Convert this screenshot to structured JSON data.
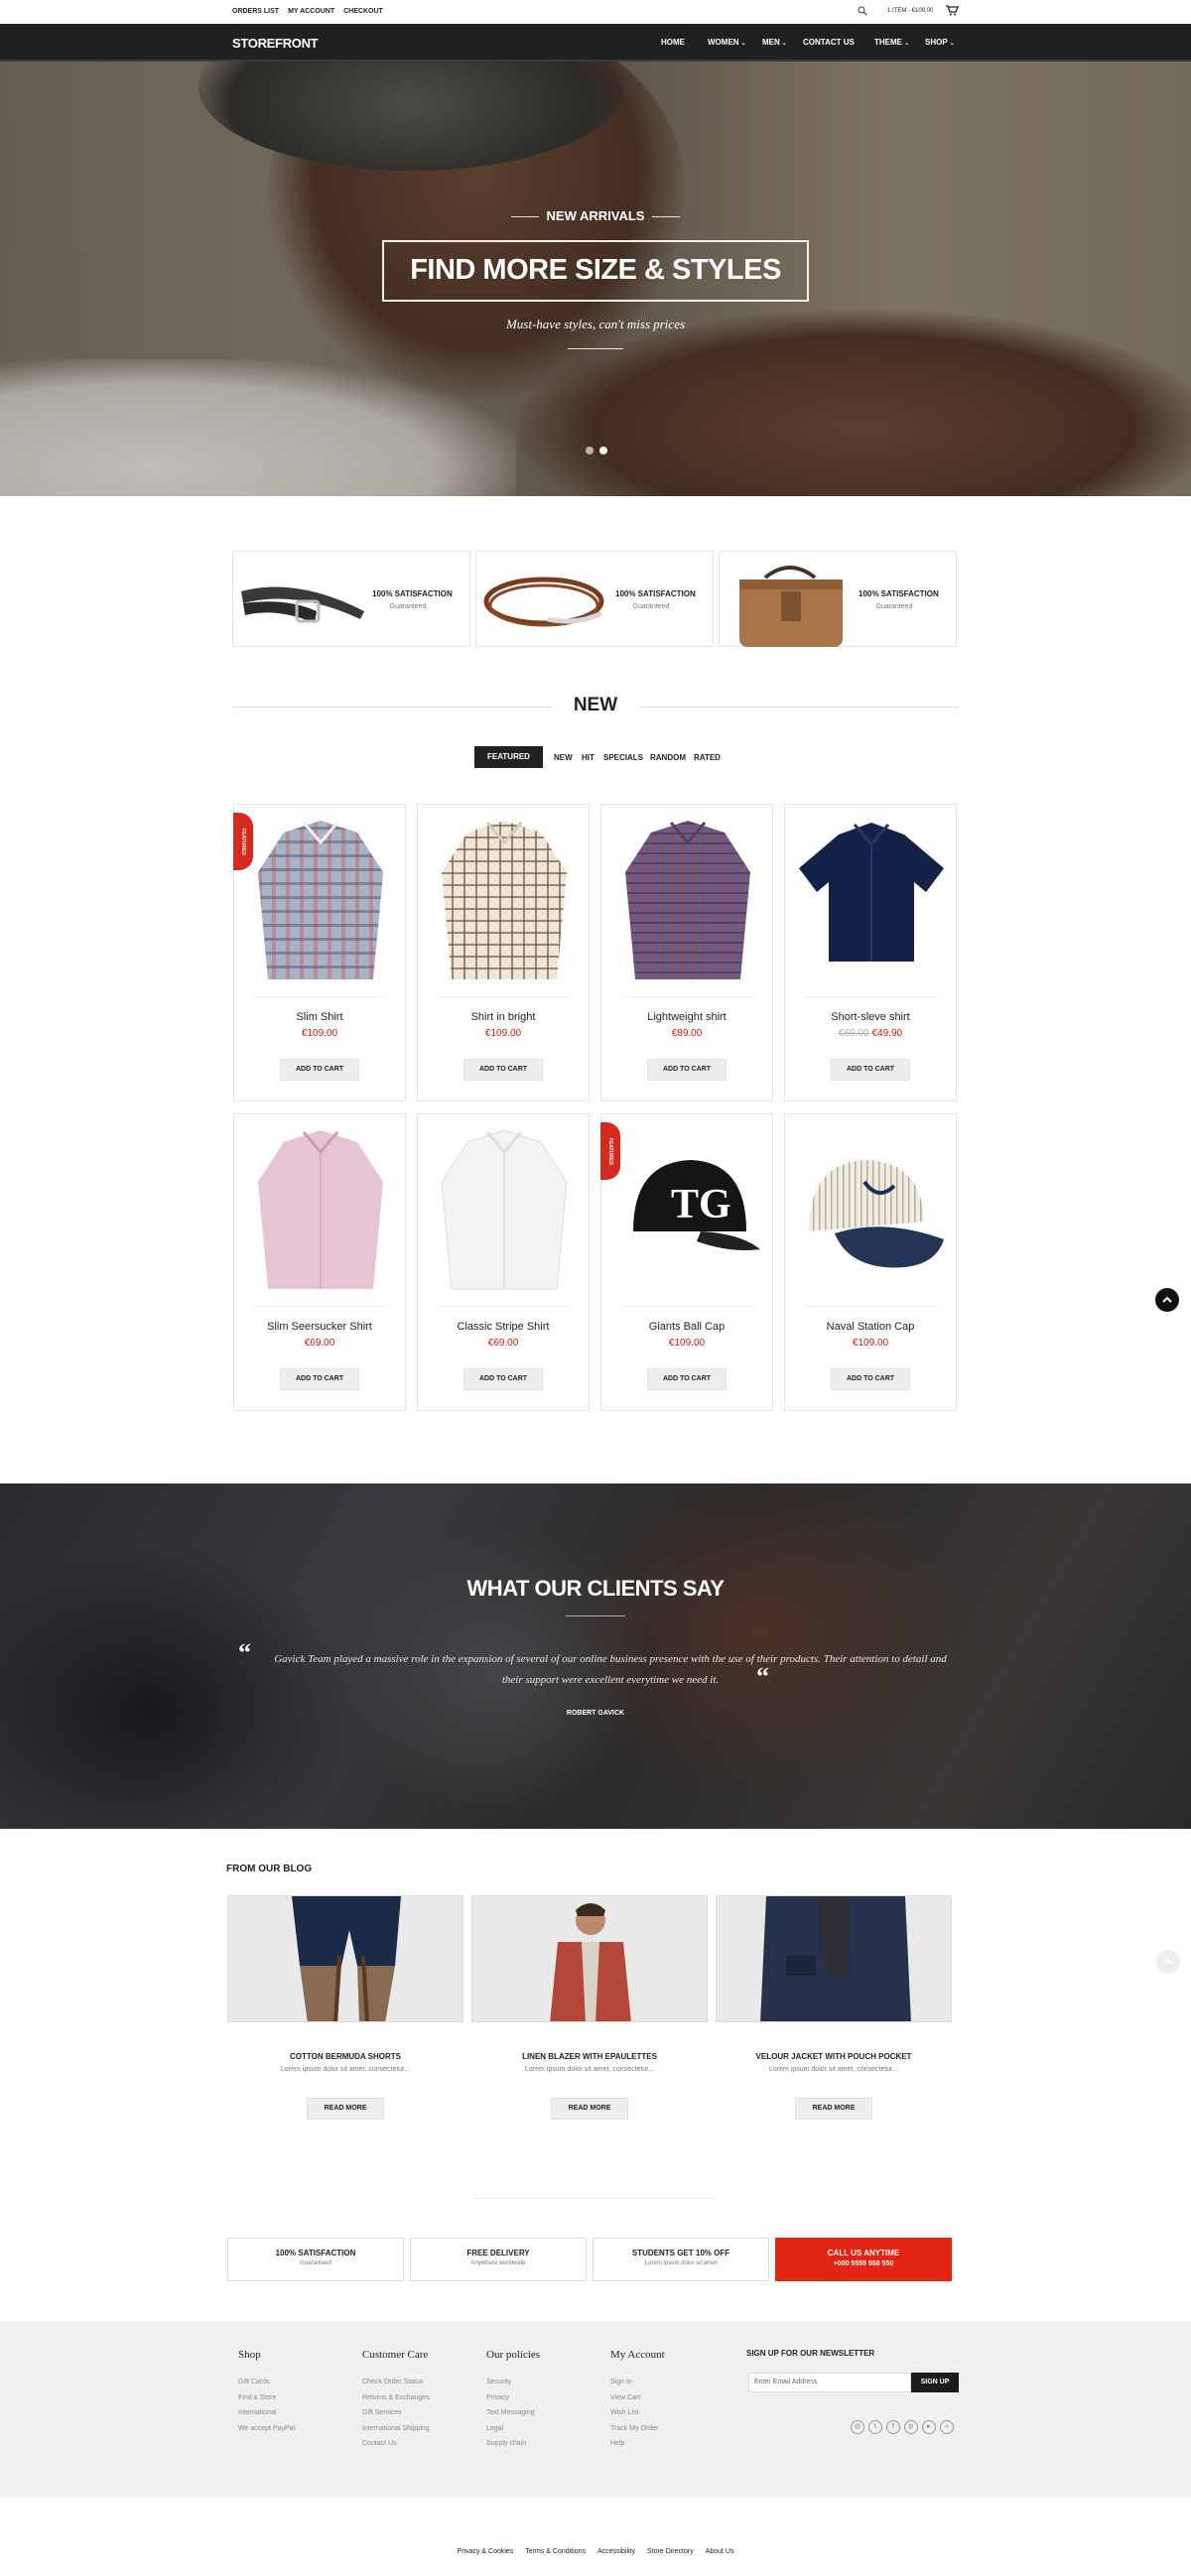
{
  "topbar": {
    "links": [
      "ORDERS LIST",
      "MY ACCOUNT",
      "CHECKOUT"
    ],
    "cart_summary": "1 ITEM - €109.00"
  },
  "nav": {
    "logo": "STOREFRONT",
    "items": [
      "HOME",
      "WOMEN",
      "MEN",
      "CONTACT US",
      "THEME",
      "SHOP"
    ]
  },
  "hero": {
    "eyebrow": "NEW ARRIVALS",
    "headline": "FIND MORE SIZE & STYLES",
    "subtitle": "Must-have styles, can't miss prices"
  },
  "promos": [
    {
      "title": "100% SATISFACTION",
      "subtitle": "Guaranteed"
    },
    {
      "title": "100% SATISFACTION",
      "subtitle": "Guaranteed"
    },
    {
      "title": "100% SATISFACTION",
      "subtitle": "Guaranteed"
    }
  ],
  "new_section": {
    "title": "NEW",
    "tabs": [
      "FEATURED",
      "NEW",
      "HIT",
      "SPECIALS",
      "RANDOM",
      "RATED"
    ]
  },
  "products": [
    {
      "name": "Slim Shirt",
      "price": "€109.00",
      "old_price": "",
      "badge": "FEATURED",
      "button": "ADD TO CART"
    },
    {
      "name": "Shirt in bright",
      "price": "€109.00",
      "old_price": "",
      "badge": "",
      "button": "ADD TO CART"
    },
    {
      "name": "Lightweight shirt",
      "price": "€89.00",
      "old_price": "",
      "badge": "",
      "button": "ADD TO CART"
    },
    {
      "name": "Short-sleve shirt",
      "price": "€49.90",
      "old_price": "€69.00",
      "badge": "",
      "button": "ADD TO CART"
    },
    {
      "name": "Slim Seersucker Shirt",
      "price": "€69.00",
      "old_price": "",
      "badge": "",
      "button": "ADD TO CART"
    },
    {
      "name": "Classic Stripe Shirt",
      "price": "€69.00",
      "old_price": "",
      "badge": "",
      "button": "ADD TO CART"
    },
    {
      "name": "Giants Ball Cap",
      "price": "€109.00",
      "old_price": "",
      "badge": "FEATURED",
      "button": "ADD TO CART"
    },
    {
      "name": "Naval Station Cap",
      "price": "€109.00",
      "old_price": "",
      "badge": "",
      "button": "ADD TO CART"
    }
  ],
  "testimonial": {
    "title": "WHAT OUR CLIENTS SAY",
    "quote": "Gavick Team played a massive role in the expansion of several of our online business presence with the use of their products. Their attention to detail and their support were excellent everytime we need it.",
    "author": "ROBERT GAVICK"
  },
  "blog": {
    "title": "FROM OUR BLOG",
    "posts": [
      {
        "title": "COTTON BERMUDA SHORTS",
        "snippet": "Lorem ipsum dolor sit amet, consectetur...",
        "button": "READ MORE"
      },
      {
        "title": "LINEN BLAZER WITH EPAULETTES",
        "snippet": "Lorem ipsum dolor sit amet, consectetur...",
        "button": "READ MORE"
      },
      {
        "title": "VELOUR JACKET WITH POUCH POCKET",
        "snippet": "Lorem ipsum dolor sit amet, consectetur...",
        "button": "READ MORE"
      }
    ]
  },
  "features": [
    {
      "title": "100% SATISFACTION",
      "subtitle": "Guaranteed"
    },
    {
      "title": "FREE DELIVERY",
      "subtitle": "Anywhere worldwide"
    },
    {
      "title": "STUDENTS GET 10% OFF",
      "subtitle": "Lorem ipsum dolor sit amet"
    },
    {
      "title": "CALL US ANYTIME",
      "subtitle": "+000 5555 558 550"
    }
  ],
  "footer": {
    "columns": [
      {
        "heading": "Shop",
        "items": [
          "Gift Cards",
          "Find a Store",
          "International",
          "We accept PayPal"
        ]
      },
      {
        "heading": "Customer Care",
        "items": [
          "Check Order Status",
          "Returns & Exchanges",
          "Gift Services",
          "International Shipping",
          "Contact Us"
        ]
      },
      {
        "heading": "Our policies",
        "items": [
          "Security",
          "Privacy",
          "Text Messaging",
          "Legal",
          "Supply chain"
        ]
      },
      {
        "heading": "My Account",
        "items": [
          "Sign In",
          "View Cart",
          "Wish List",
          "Track My Order",
          "Help"
        ]
      }
    ],
    "newsletter": {
      "heading": "SIGN UP FOR OUR NEWSLETTER",
      "placeholder": "Enter Email Address",
      "button": "SIGN UP"
    },
    "social_icons": [
      "dribbble-icon",
      "twitter-icon",
      "facebook-icon",
      "pinterest-icon",
      "youtube-icon",
      "rss-icon"
    ]
  },
  "bottom_links": [
    "Privacy & Cookies",
    "Terms & Conditions",
    "Accessibility",
    "Store Directory",
    "About Us"
  ],
  "colors": {
    "accent": "#e12413",
    "dark": "#1f2021",
    "price": "#d2180b"
  }
}
